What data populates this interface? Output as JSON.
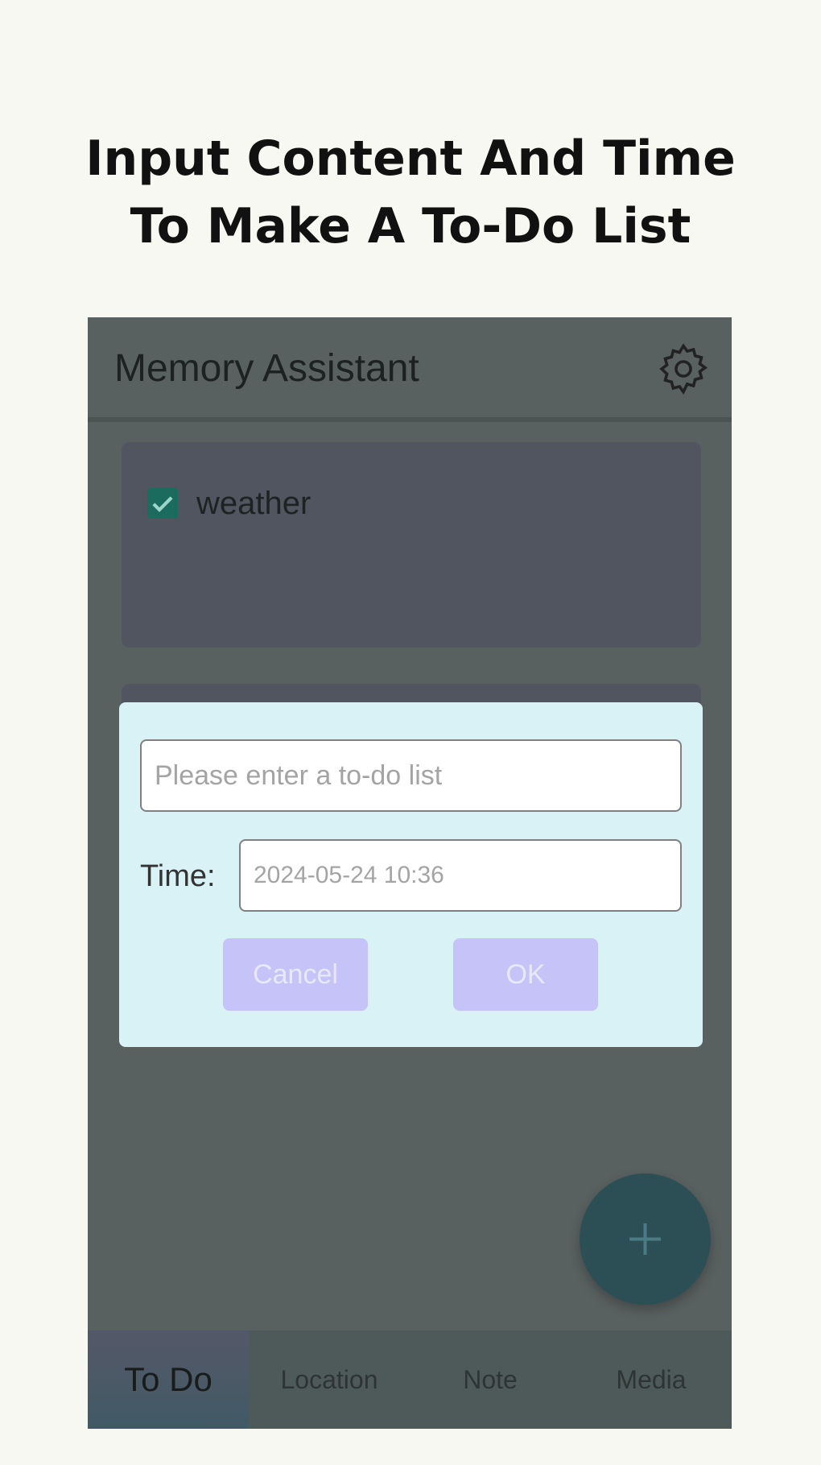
{
  "headline": {
    "line1": "Input Content And Time",
    "line2": "To Make A To-Do List"
  },
  "app": {
    "title": "Memory Assistant",
    "settings_icon": "gear-icon"
  },
  "todos": [
    {
      "text": "weather",
      "checked": true
    }
  ],
  "dialog": {
    "content_placeholder": "Please enter a to-do list",
    "time_label": "Time:",
    "time_value": "2024-05-24 10:36",
    "cancel_label": "Cancel",
    "ok_label": "OK"
  },
  "fab": {
    "icon": "plus-icon"
  },
  "bottom_nav": {
    "items": [
      {
        "label": "To Do",
        "active": true
      },
      {
        "label": "Location",
        "active": false
      },
      {
        "label": "Note",
        "active": false
      },
      {
        "label": "Media",
        "active": false
      }
    ]
  },
  "colors": {
    "check_fill": "#1b6b5e",
    "dialog_bg": "#d9f2f5",
    "button_bg": "#c5c3f7",
    "fab_bg": "#2c4f55"
  }
}
